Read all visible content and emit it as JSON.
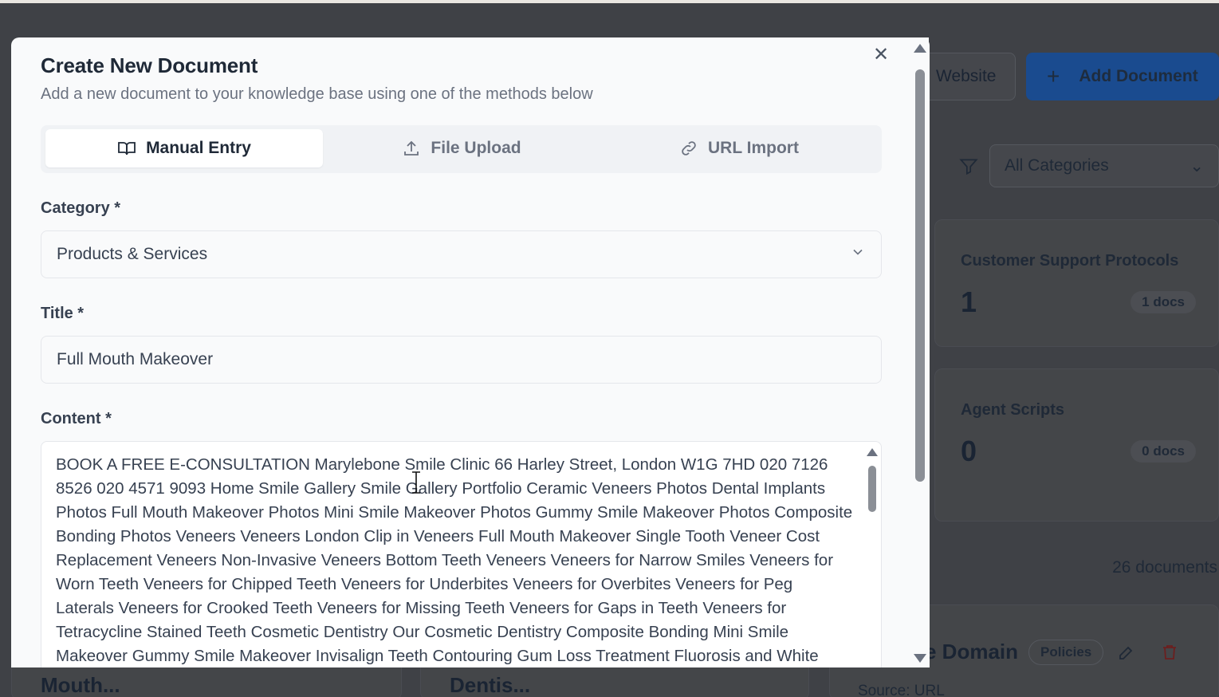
{
  "background": {
    "website_button": "Website",
    "add_document_button": "Add Document",
    "category_filter": "All Categories",
    "cards": [
      {
        "title": "Customer Support Protocols",
        "count": "1",
        "badge": "1 docs"
      },
      {
        "title": "Agent Scripts",
        "count": "0",
        "badge": "0 docs"
      }
    ],
    "documents_count": "26 documents",
    "doc_titles": [
      "Mouth...",
      "Dentis...",
      "e Domain"
    ],
    "doc_badge": "Policies",
    "doc_source": "Source: URL"
  },
  "modal": {
    "title": "Create New Document",
    "subtitle": "Add a new document to your knowledge base using one of the methods below",
    "tabs": [
      {
        "label": "Manual Entry",
        "icon": "book-icon",
        "active": true
      },
      {
        "label": "File Upload",
        "icon": "upload-icon",
        "active": false
      },
      {
        "label": "URL Import",
        "icon": "link-icon",
        "active": false
      }
    ],
    "category_label": "Category *",
    "category_value": "Products & Services",
    "title_label": "Title *",
    "title_value": "Full Mouth Makeover",
    "content_label": "Content *",
    "content_value": "BOOK A FREE E-CONSULTATION Marylebone Smile Clinic 66 Harley Street, London W1G 7HD 020 7126 8526 020 4571 9093 Home Smile Gallery Smile Gallery Portfolio Ceramic Veneers Photos Dental Implants Photos Full Mouth Makeover Photos Mini Smile Makeover Photos Gummy Smile Makeover Photos Composite Bonding Photos Veneers Veneers London Clip in Veneers Full Mouth Makeover Single Tooth Veneer Cost Replacement Veneers Non-Invasive Veneers Bottom Teeth Veneers Veneers for Narrow Smiles Veneers for Worn Teeth Veneers for Chipped Teeth Veneers for Underbites Veneers for Overbites Veneers for Peg Laterals Veneers for Crooked Teeth Veneers for Missing Teeth Veneers for Gaps in Teeth Veneers for Tetracycline Stained Teeth Cosmetic Dentistry Our Cosmetic Dentistry Composite Bonding Mini Smile Makeover Gummy Smile Makeover Invisalign Teeth Contouring Gum Loss Treatment Fluorosis and White"
  }
}
